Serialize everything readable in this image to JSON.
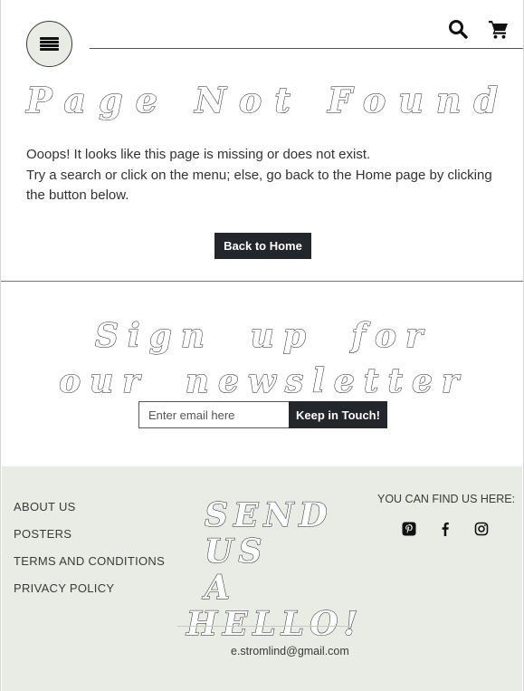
{
  "header": {
    "menu_icon": "hamburger-icon",
    "search_icon": "search-icon",
    "cart_icon": "cart-icon"
  },
  "not_found": {
    "title": "Page Not Found",
    "line1": "Ooops! It looks like this page is missing or does not exist.",
    "line2": "Try a search or click on the menu; else, go back to the Home page by clicking the button below.",
    "button_label": "Back to Home"
  },
  "newsletter": {
    "title": "Sign up for our newsletter",
    "email_placeholder": "Enter email here",
    "button_label": "Keep in Touch!"
  },
  "footer": {
    "links": [
      "ABOUT US",
      "POSTERS",
      "TERMS AND CONDITIONS",
      "PRIVACY POLICY"
    ],
    "hello_line1": "SEND",
    "hello_line2": "US A",
    "hello_line3": "HELLO!",
    "email": "e.stromlind@gmail.com",
    "find_us": "YOU CAN FIND US HERE:",
    "social_icons": [
      "pinterest-icon",
      "facebook-icon",
      "instagram-icon"
    ]
  },
  "colors": {
    "footer_bg": "#e8ece5",
    "button_bg": "#23262b",
    "text": "#333333"
  }
}
